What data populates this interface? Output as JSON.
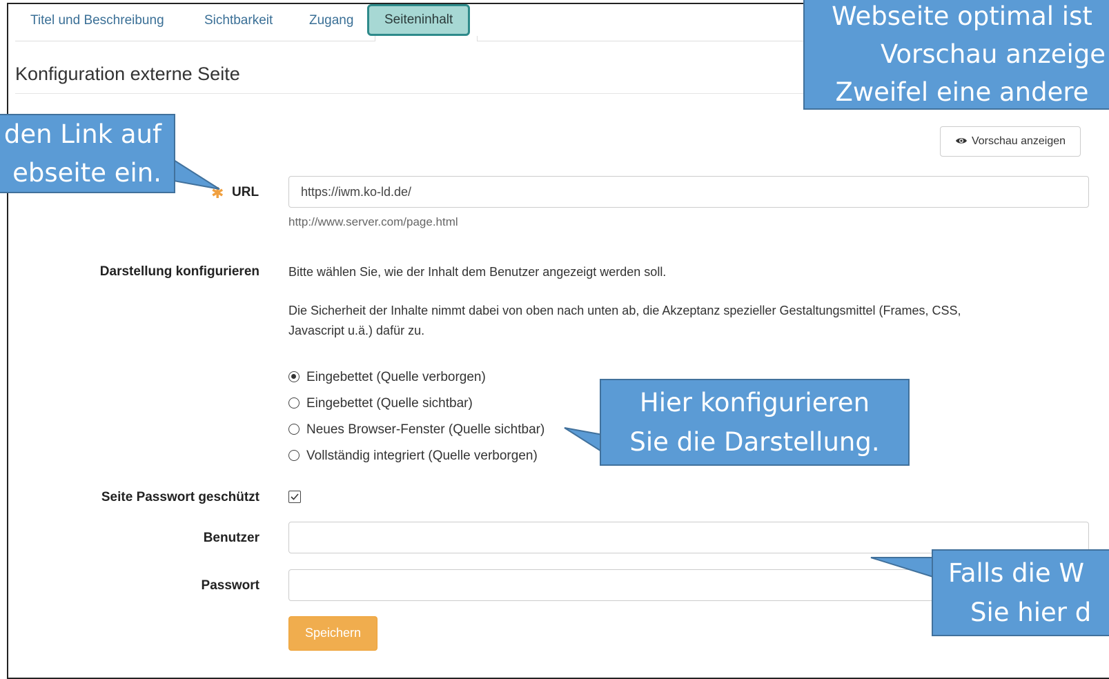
{
  "tabs": [
    {
      "label": "Titel und Beschreibung"
    },
    {
      "label": "Sichtbarkeit"
    },
    {
      "label": "Zugang"
    },
    {
      "label": "Seiteninhalt",
      "active": true
    }
  ],
  "section_title": "Konfiguration externe Seite",
  "preview_button": "Vorschau anzeigen",
  "url": {
    "label": "URL",
    "value": "https://iwm.ko-ld.de/",
    "hint": "http://www.server.com/page.html"
  },
  "display": {
    "label": "Darstellung konfigurieren",
    "intro": "Bitte wählen Sie, wie der Inhalt dem Benutzer angezeigt werden soll.",
    "note_line1": "Die Sicherheit der Inhalte nimmt dabei von oben nach unten ab, die Akzeptanz spezieller Gestaltungsmittel (Frames, CSS,",
    "note_line2": "Javascript u.ä.) dafür zu.",
    "options": [
      {
        "label": "Eingebettet (Quelle verborgen)",
        "checked": true
      },
      {
        "label": "Eingebettet (Quelle sichtbar)",
        "checked": false
      },
      {
        "label": "Neues Browser-Fenster (Quelle sichtbar)",
        "checked": false
      },
      {
        "label": "Vollständig integriert (Quelle verborgen)",
        "checked": false
      }
    ]
  },
  "password_protected": {
    "label": "Seite Passwort geschützt",
    "checked": true
  },
  "user": {
    "label": "Benutzer",
    "value": ""
  },
  "password": {
    "label": "Passwort",
    "value": ""
  },
  "save_button": "Speichern",
  "callouts": {
    "top_right": [
      "Webseite optimal ist",
      "Vorschau anzeige",
      "Zweifel eine andere"
    ],
    "left": [
      "den Link auf",
      "ebseite ein."
    ],
    "middle": [
      "Hier konfigurieren",
      "Sie die Darstellung."
    ],
    "bottom_right": [
      "Falls die W",
      "Sie hier d"
    ]
  },
  "colors": {
    "callout_fill": "#5b9bd5",
    "callout_border": "#41719c",
    "active_tab": "#a7d8d4",
    "save_button": "#f0ad4e",
    "tab_link": "#3a6f96"
  },
  "icons": [
    "eye-icon",
    "required-star-icon",
    "checkmark-icon"
  ]
}
